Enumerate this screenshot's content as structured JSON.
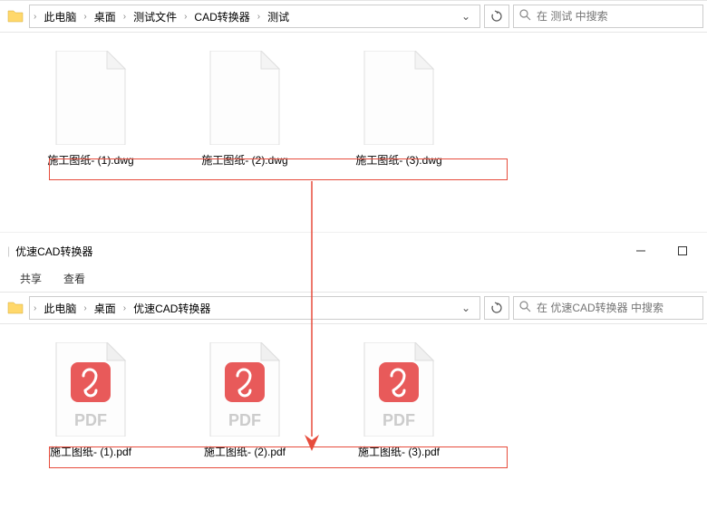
{
  "window1": {
    "breadcrumb": [
      "此电脑",
      "桌面",
      "测试文件",
      "CAD转换器",
      "测试"
    ],
    "search_placeholder": "在 测试 中搜索",
    "files": [
      {
        "name": "施工图纸- (1).dwg"
      },
      {
        "name": "施工图纸- (2).dwg"
      },
      {
        "name": "施工图纸- (3).dwg"
      }
    ]
  },
  "window2": {
    "title": "优速CAD转换器",
    "ribbon": {
      "share": "共享",
      "view": "查看"
    },
    "breadcrumb": [
      "此电脑",
      "桌面",
      "优速CAD转换器"
    ],
    "search_placeholder": "在 优速CAD转换器 中搜索",
    "files": [
      {
        "name": "施工图纸- (1).pdf"
      },
      {
        "name": "施工图纸- (2).pdf"
      },
      {
        "name": "施工图纸- (3).pdf"
      }
    ]
  },
  "colors": {
    "pdf_red": "#e85a5a",
    "selection": "#e74c3c",
    "arrow": "#e74c3c"
  }
}
